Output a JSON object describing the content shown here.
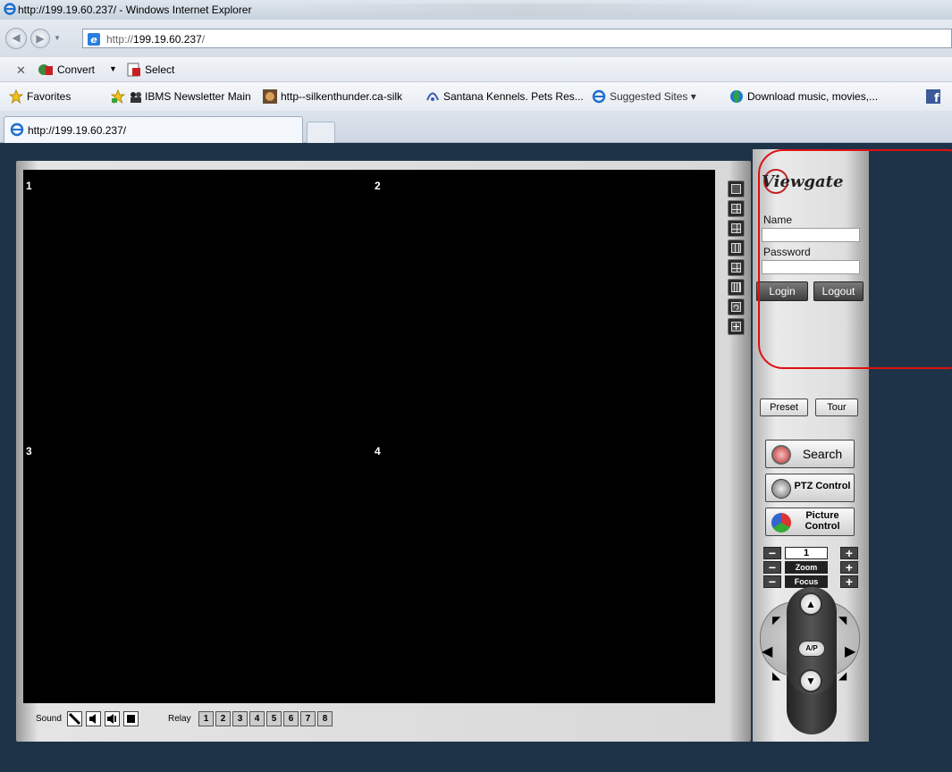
{
  "browser": {
    "window_title": "http://199.19.60.237/ - Windows Internet Explorer",
    "address": {
      "prefix": "http://",
      "host": "199.19.60.237",
      "suffix": "/"
    },
    "command_bar": {
      "convert_label": "Convert",
      "select_label": "Select"
    },
    "favorites": {
      "label": "Favorites",
      "items": [
        "IBMS Newsletter Main",
        "http--silkenthunder.ca-silk",
        "Santana Kennels. Pets Res...",
        "Suggested Sites ▾",
        "Download music, movies,..."
      ]
    },
    "tab_title": "http://199.19.60.237/"
  },
  "viewer": {
    "channels": [
      "1",
      "2",
      "3",
      "4"
    ],
    "sound_label": "Sound",
    "relay_label": "Relay",
    "relays": [
      "1",
      "2",
      "3",
      "4",
      "5",
      "6",
      "7",
      "8"
    ]
  },
  "login": {
    "logo": "Viewgate",
    "name_label": "Name",
    "password_label": "Password",
    "name_value": "",
    "password_value": "",
    "login_button": "Login",
    "logout_button": "Logout"
  },
  "controls": {
    "preset_button": "Preset",
    "tour_button": "Tour",
    "search_button": "Search",
    "ptz_button": "PTZ Control",
    "picture_button_line1": "Picture",
    "picture_button_line2": "Control",
    "speed_value": "1",
    "zoom_label": "Zoom",
    "focus_label": "Focus",
    "minus": "−",
    "plus": "+",
    "ap_label": "A/P"
  },
  "colors": {
    "page_background": "#1e3347",
    "highlight_outline": "#e01010"
  }
}
